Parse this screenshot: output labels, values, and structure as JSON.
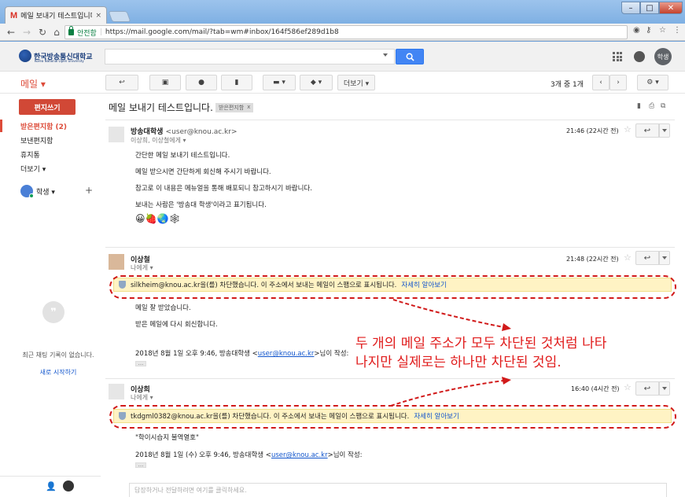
{
  "browser": {
    "tab_title": "메일 보내기 테스트입니다.",
    "tab_close": "×",
    "secure_label": "안전함",
    "url": "https://mail.google.com/mail/?tab=wm#inbox/164f586ef289d1b8"
  },
  "header": {
    "logo_text": "한국방송통신대학교",
    "logo_sub": "Korea National Open University",
    "avatar_label": "학생"
  },
  "toolbar": {
    "mail_menu": "메일 ▾",
    "more_label": "더보기 ▾",
    "pager": "3개 중 1개"
  },
  "sidebar": {
    "compose": "편지쓰기",
    "items": [
      {
        "label": "받은편지함 (2)"
      },
      {
        "label": "보낸편지함"
      },
      {
        "label": "휴지통"
      },
      {
        "label": "더보기 ▾"
      }
    ],
    "hangout_user": "학생 ▾",
    "chat_empty": "최근 채팅 기록이 없습니다.",
    "chat_new": "새로 시작하기"
  },
  "thread": {
    "subject": "메일 보내기 테스트입니다.",
    "label": "받은편지함",
    "label_close": "x",
    "messages": [
      {
        "sender": "방송대학생",
        "email": "<user@knou.ac.kr>",
        "to": "이상희, 이상철에게 ▾",
        "time": "21:46 (22시간 전)",
        "body": [
          "간단한 메일 보내기 테스트입니다.",
          "메일 받으시면 간단하게 회신해 주시기 바랍니다.",
          "참고로 이 내용은 메뉴얼을 통해 배포되니 참고하시기 바랍니다.",
          "보내는 사람은 '방송대 학생'이라고 표기됩니다."
        ],
        "emoji": "😀🍓🌏🕸"
      },
      {
        "sender": "이상철",
        "to": "나에게 ▾",
        "time": "21:48 (22시간 전)",
        "spam_text": "silkheim@knou.ac.kr을(를) 차단했습니다. 이 주소에서 보내는 메일이 스팸으로 표시됩니다.",
        "learn_more": "자세히 알아보기",
        "body": [
          "메일 잘 받았습니다.",
          "받은 메일에 다시 회신합니다."
        ],
        "quote_prefix": "2018년 8월 1일 오후 9:46, 방송대학생 <",
        "quote_link": "user@knou.ac.kr",
        "quote_suffix": ">님이 작성:"
      },
      {
        "sender": "이상희",
        "to": "나에게 ▾",
        "time": "16:40 (4시간 전)",
        "spam_text": "tkdgml0382@knou.ac.kr을(를) 차단했습니다. 이 주소에서 보내는 메일이 스팸으로 표시됩니다.",
        "learn_more": "자세히 알아보기",
        "body": [
          "\"학이시습지 불역열호\""
        ],
        "quote_prefix": "2018년 8월 1일 (수) 오후 9:46, 방송대학생 <",
        "quote_link": "user@knou.ac.kr",
        "quote_suffix": ">님이 작성:"
      }
    ],
    "reply_placeholder": "답장하거나 전달하려면 여기를 클릭하세요."
  },
  "annotation": {
    "line1": "두 개의 메일 주소가 모두 차단된 것처럼  나타",
    "line2": "나지만 실제로는 하나만 차단된 것임.",
    "color": "#e01b1b"
  },
  "colors": {
    "compose_red": "#d14836",
    "gmail_red": "#dd4b39",
    "search_blue": "#4285f4",
    "spam_yellow": "#fff3c4",
    "link_blue": "#1155cc"
  }
}
